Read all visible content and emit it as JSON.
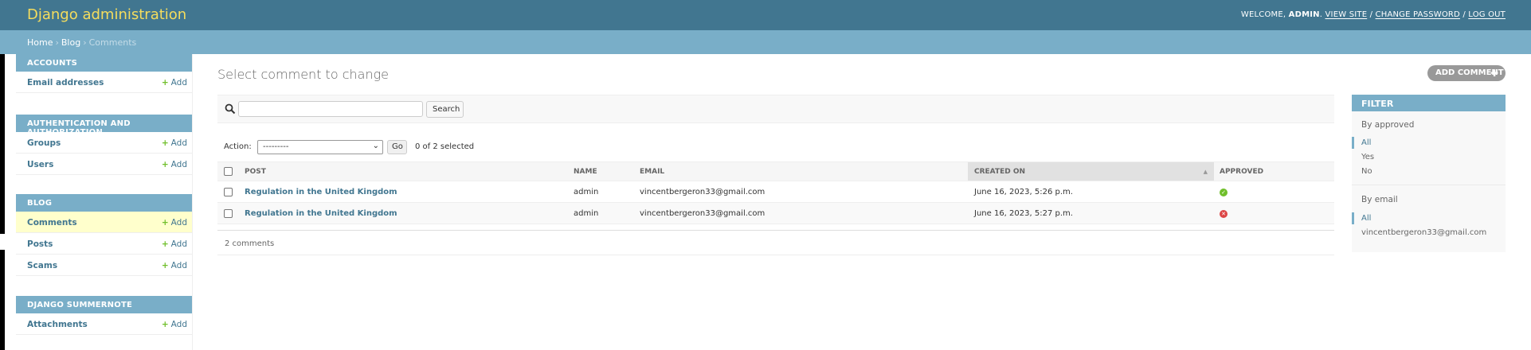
{
  "header": {
    "brand": "Django administration",
    "welcome": "WELCOME,",
    "user": "ADMIN",
    "view_site": "VIEW SITE",
    "change_password": "CHANGE PASSWORD",
    "log_out": "LOG OUT"
  },
  "breadcrumbs": {
    "home": "Home",
    "app": "Blog",
    "current": "Comments"
  },
  "sidebar": {
    "add_label": "Add",
    "modules": [
      {
        "caption": "ACCOUNTS",
        "models": [
          "Email addresses"
        ]
      },
      {
        "caption": "AUTHENTICATION AND AUTHORIZATION",
        "models": [
          "Groups",
          "Users"
        ]
      },
      {
        "caption": "BLOG",
        "models": [
          "Comments",
          "Posts",
          "Scams"
        ],
        "current": "Comments"
      },
      {
        "caption": "DJANGO SUMMERNOTE",
        "models": [
          "Attachments"
        ]
      }
    ]
  },
  "main": {
    "title": "Select comment to change",
    "add_button": "ADD COMMENT",
    "search_button": "Search",
    "search_value": "",
    "action_label": "Action:",
    "action_selected": "---------",
    "go_button": "Go",
    "selection_count": "0 of 2 selected",
    "columns": [
      "POST",
      "NAME",
      "EMAIL",
      "CREATED ON",
      "APPROVED"
    ],
    "sorted_column": "CREATED ON",
    "rows": [
      {
        "post": "Regulation in the United Kingdom",
        "name": "admin",
        "email": "vincentbergeron33@gmail.com",
        "created_on": "June 16, 2023, 5:26 p.m.",
        "approved": true
      },
      {
        "post": "Regulation in the United Kingdom",
        "name": "admin",
        "email": "vincentbergeron33@gmail.com",
        "created_on": "June 16, 2023, 5:27 p.m.",
        "approved": false
      }
    ],
    "result_count": "2 comments"
  },
  "filter": {
    "caption": "FILTER",
    "approved_heading": "By approved",
    "approved_options": [
      "All",
      "Yes",
      "No"
    ],
    "email_heading": "By email",
    "email_options": [
      "All",
      "vincentbergeron33@gmail.com"
    ]
  },
  "colors": {
    "header_bg": "#417690",
    "brand": "#f5dd5d",
    "caption_bg": "#79aec8",
    "link": "#417690",
    "add_plus": "#70bf2b",
    "current_row": "#ffffcc",
    "approved_yes": "#70bf2b",
    "approved_no": "#dd4646"
  }
}
